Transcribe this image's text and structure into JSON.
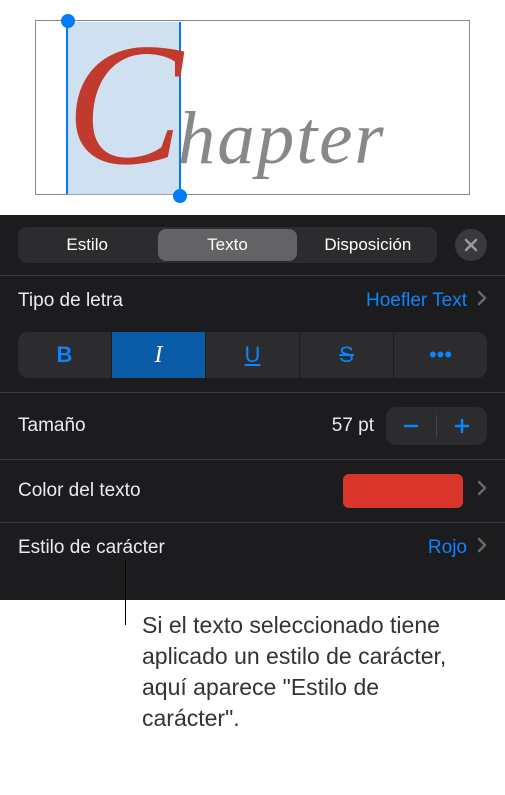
{
  "canvas": {
    "drop_cap": "C",
    "rest": "hapter"
  },
  "tabs": {
    "style": "Estilo",
    "text": "Texto",
    "layout": "Disposición"
  },
  "font_row": {
    "label": "Tipo de letra",
    "value": "Hoefler Text"
  },
  "style_buttons": {
    "bold": "B",
    "italic": "I",
    "underline": "U",
    "strike": "S",
    "more": "•••"
  },
  "size_row": {
    "label": "Tamaño",
    "value": "57 pt"
  },
  "color_row": {
    "label": "Color del texto",
    "swatch_color": "#d9352a"
  },
  "char_style_row": {
    "label": "Estilo de carácter",
    "value": "Rojo"
  },
  "annotation": "Si el texto seleccionado tiene aplicado un estilo de carácter, aquí aparece \"Estilo de carácter\"."
}
